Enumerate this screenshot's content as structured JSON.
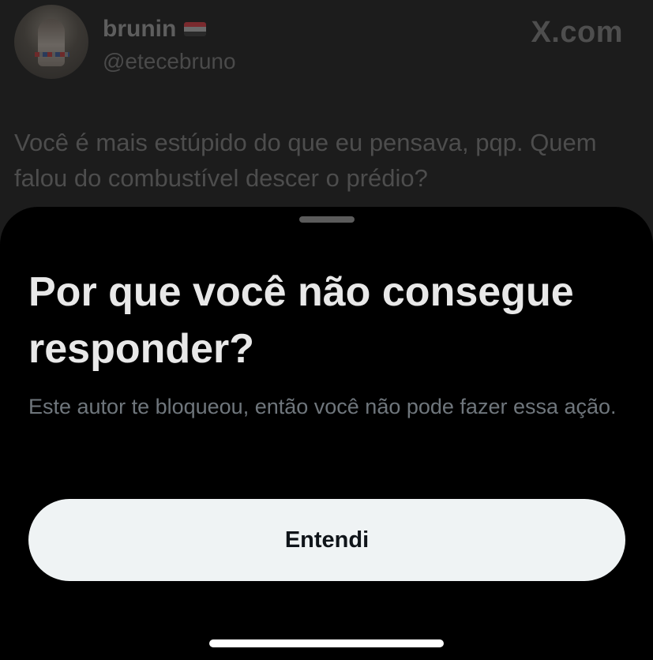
{
  "tweet": {
    "display_name": "brunin",
    "flag_icon": "flag-icon",
    "handle": "@etecebruno",
    "text": "Você é mais estúpido do que eu pensava, pqp. Quem falou do combustível descer o prédio?"
  },
  "watermark": "X.com",
  "sheet": {
    "title": "Por que você não consegue responder?",
    "description": "Este autor te bloqueou, então você não pode fazer essa ação.",
    "button_label": "Entendi"
  },
  "colors": {
    "sheet_background": "#000000",
    "button_background": "#eff3f4",
    "title_color": "#e8e8e8",
    "description_color": "#6f767c"
  }
}
